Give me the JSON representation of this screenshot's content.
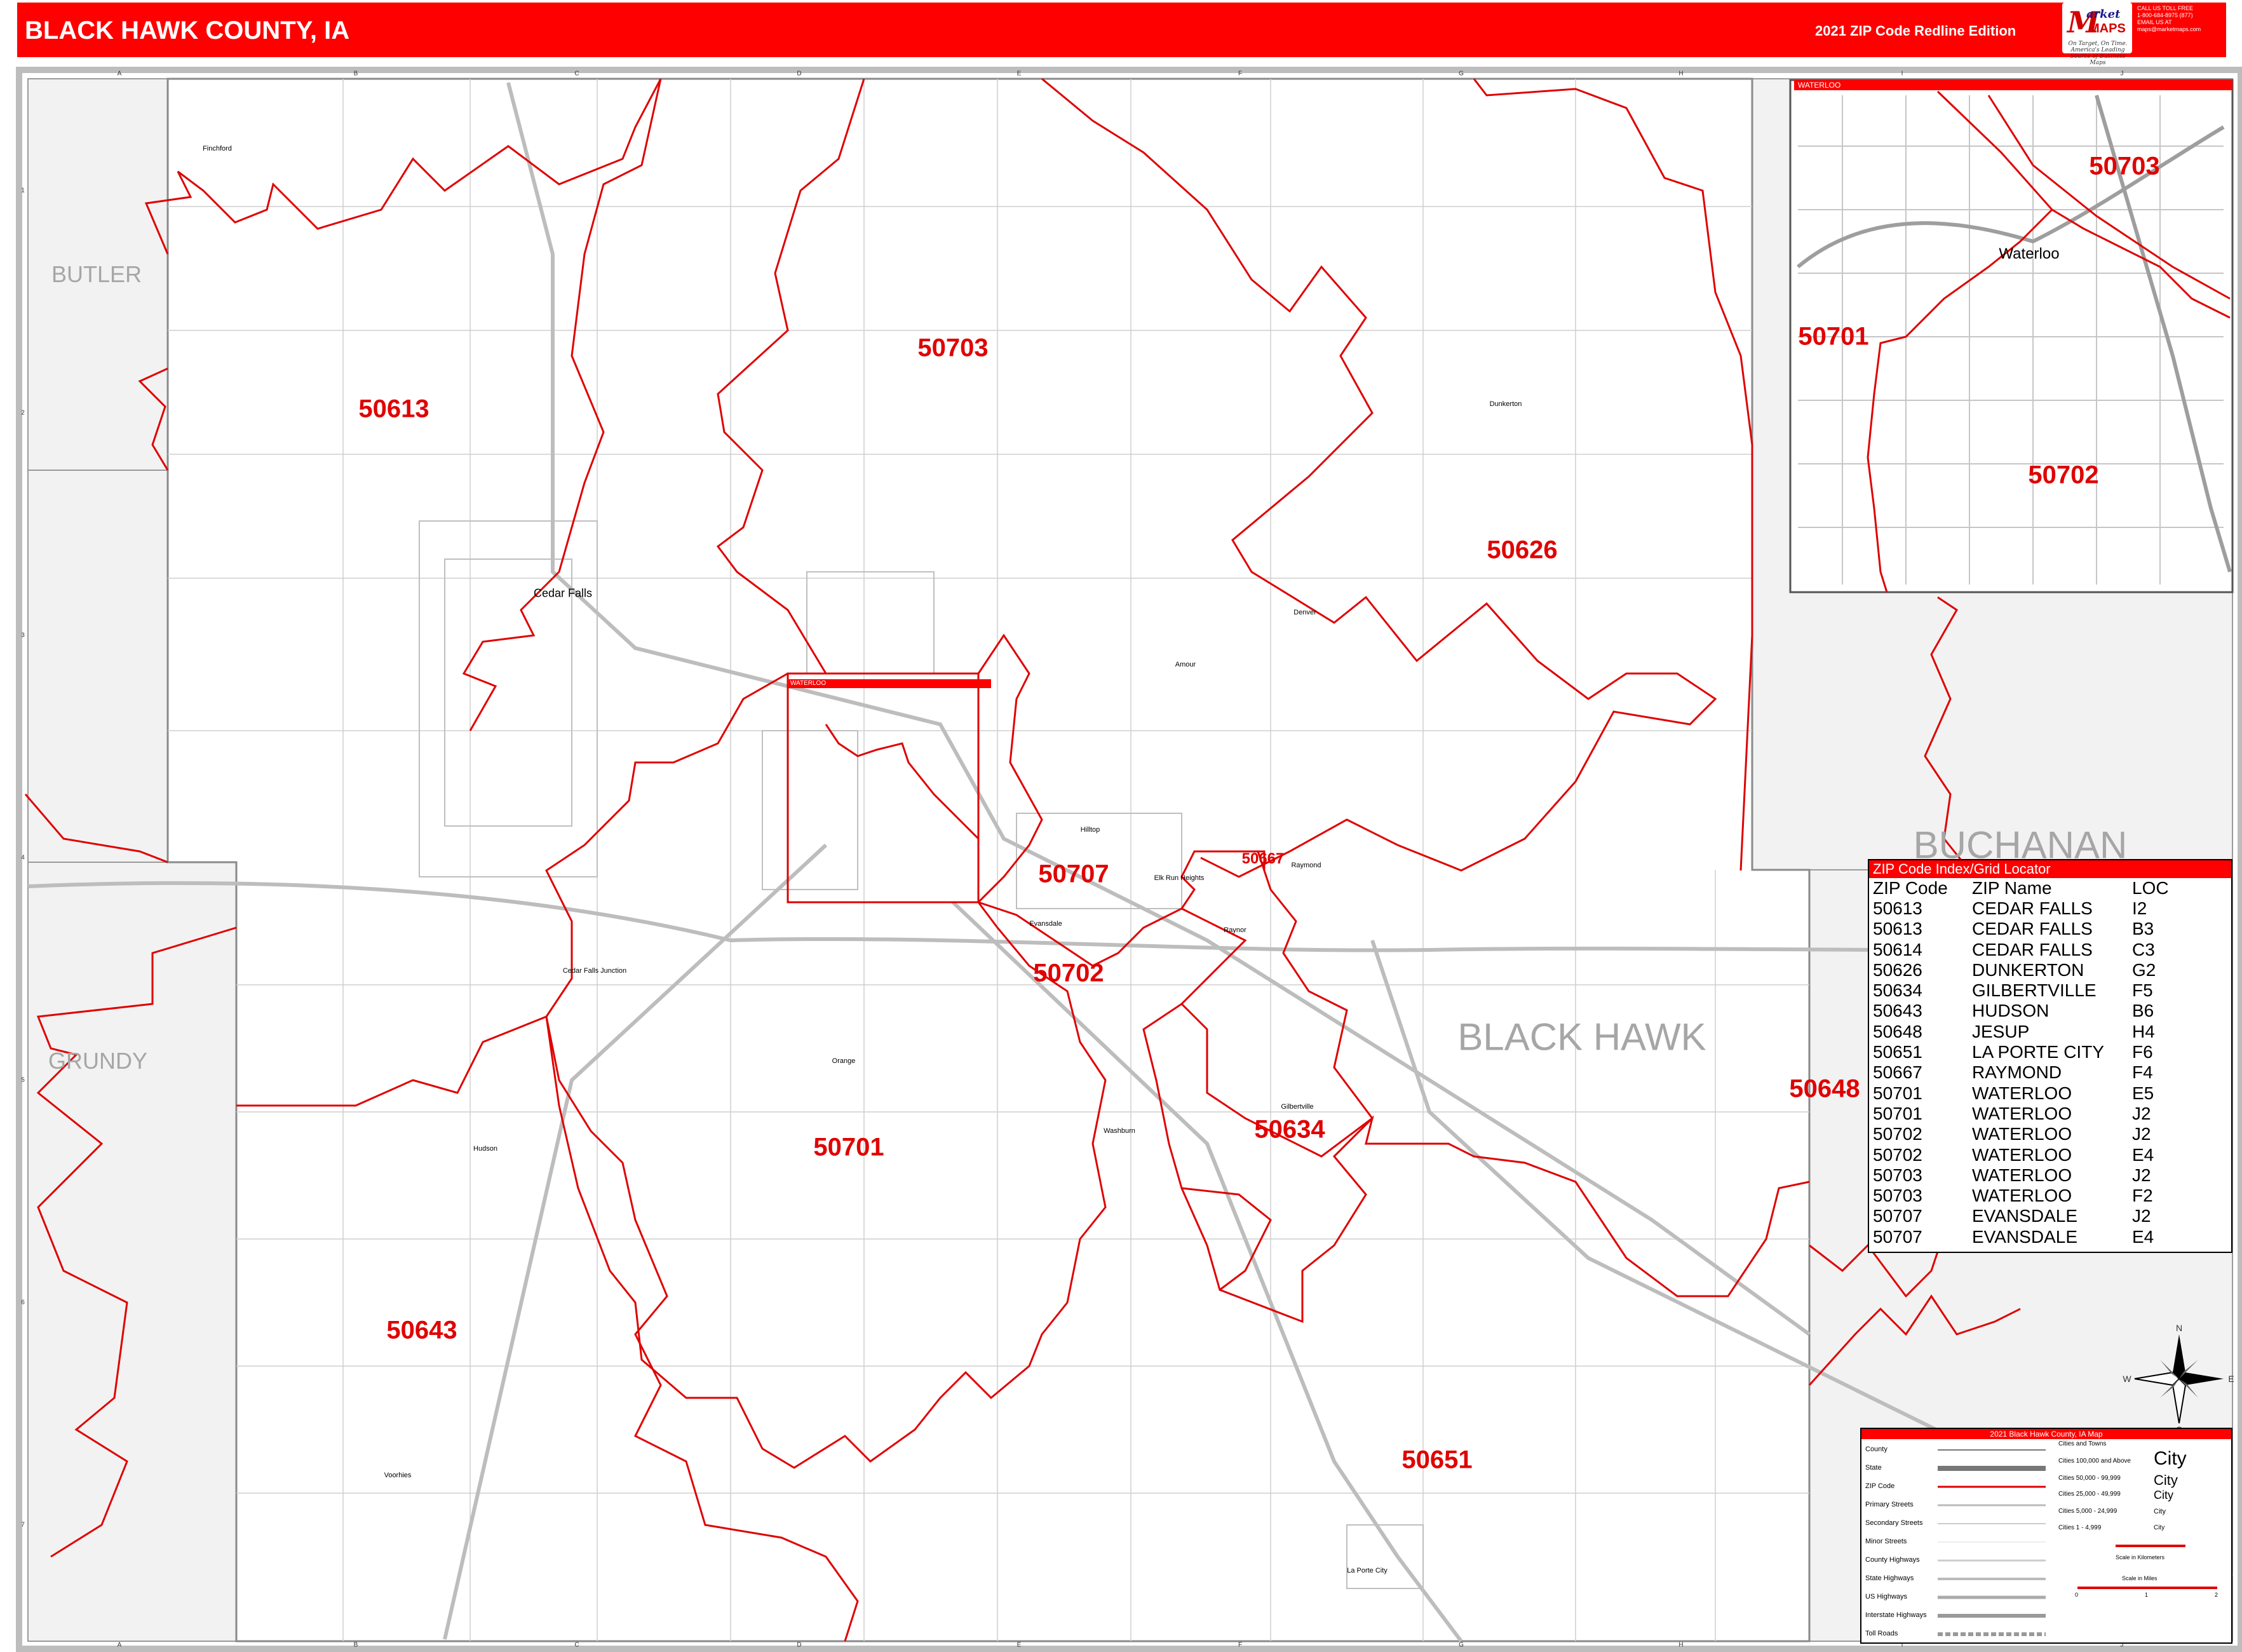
{
  "header": {
    "title": "BLACK HAWK COUNTY, IA",
    "edition": "2021 ZIP Code Redline Edition"
  },
  "logo": {
    "letter": "M",
    "word1": "arket",
    "word2": "MAPS",
    "tagline": "On Target, On Time. America's Leading Source of Business Maps",
    "contact": [
      "CALL US TOLL FREE",
      "1-800-684-8975 (877)",
      "EMAIL US AT",
      "maps@marketmaps.com"
    ]
  },
  "colors": {
    "header_red": "#ff0000",
    "zip_label": "#e00000",
    "zip_boundary": "#e00000",
    "neighbor_county_fill": "#f2f2f2",
    "county_label": "#a6a6a6",
    "roads": "#c8c8c8"
  },
  "zip_labels": [
    "50703",
    "50613",
    "50626",
    "50707",
    "50667",
    "50702",
    "50701",
    "50634",
    "50648",
    "50643",
    "50651"
  ],
  "inset": {
    "title": "WATERLOO",
    "city": "Waterloo",
    "zip_labels": [
      "50703",
      "50701",
      "50702"
    ]
  },
  "main_inset_marker": "WATERLOO",
  "counties": [
    "BUTLER",
    "GRUNDY",
    "BUCHANAN",
    "BLACK HAWK"
  ],
  "cities": [
    "Cedar Falls",
    "Dunkerton",
    "Denver",
    "Amour",
    "Hilltop",
    "Raymond",
    "Elk Run Heights",
    "Raynor",
    "Evansdale",
    "Orange",
    "Washburn",
    "Gilbertville",
    "Hudson",
    "Cedar Falls Junction",
    "Voorhies",
    "La Porte City",
    "Finchford"
  ],
  "grid": {
    "columns": [
      "A",
      "B",
      "C",
      "D",
      "E",
      "F",
      "G",
      "H",
      "I",
      "J"
    ],
    "rows": [
      "1",
      "2",
      "3",
      "4",
      "5",
      "6",
      "7"
    ]
  },
  "zip_index": {
    "title": "ZIP Code Index/Grid Locator",
    "headers": [
      "ZIP Code",
      "ZIP Name",
      "LOC"
    ],
    "rows": [
      [
        "50613",
        "CEDAR FALLS",
        "I2"
      ],
      [
        "50613",
        "CEDAR FALLS",
        "B3"
      ],
      [
        "50614",
        "CEDAR FALLS",
        "C3"
      ],
      [
        "50626",
        "DUNKERTON",
        "G2"
      ],
      [
        "50634",
        "GILBERTVILLE",
        "F5"
      ],
      [
        "50643",
        "HUDSON",
        "B6"
      ],
      [
        "50648",
        "JESUP",
        "H4"
      ],
      [
        "50651",
        "LA PORTE CITY",
        "F6"
      ],
      [
        "50667",
        "RAYMOND",
        "F4"
      ],
      [
        "50701",
        "WATERLOO",
        "E5"
      ],
      [
        "50701",
        "WATERLOO",
        "J2"
      ],
      [
        "50702",
        "WATERLOO",
        "J2"
      ],
      [
        "50702",
        "WATERLOO",
        "E4"
      ],
      [
        "50703",
        "WATERLOO",
        "J2"
      ],
      [
        "50703",
        "WATERLOO",
        "F2"
      ],
      [
        "50707",
        "EVANSDALE",
        "J2"
      ],
      [
        "50707",
        "EVANSDALE",
        "E4"
      ]
    ]
  },
  "legend": {
    "title": "2021 Black Hawk County, IA Map",
    "items": [
      "County",
      "State",
      "ZIP Code",
      "Primary Streets",
      "Secondary Streets",
      "Minor Streets",
      "County Highways",
      "State Highways",
      "US Highways",
      "Interstate Highways",
      "Toll Roads"
    ],
    "cities_header": "Cities and Towns",
    "city_sizes": [
      "Cities 100,000 and Above",
      "Cities 50,000 - 99,999",
      "Cities 25,000 - 49,999",
      "Cities 5,000 - 24,999",
      "Cities 1 - 4,999"
    ],
    "city_demo": "City",
    "scale_km": "Scale in Kilometers",
    "scale_mi": "Scale in Miles",
    "scale_ticks": [
      "0",
      "1",
      "2"
    ]
  },
  "compass": {
    "n": "N",
    "s": "S",
    "e": "E",
    "w": "W"
  }
}
